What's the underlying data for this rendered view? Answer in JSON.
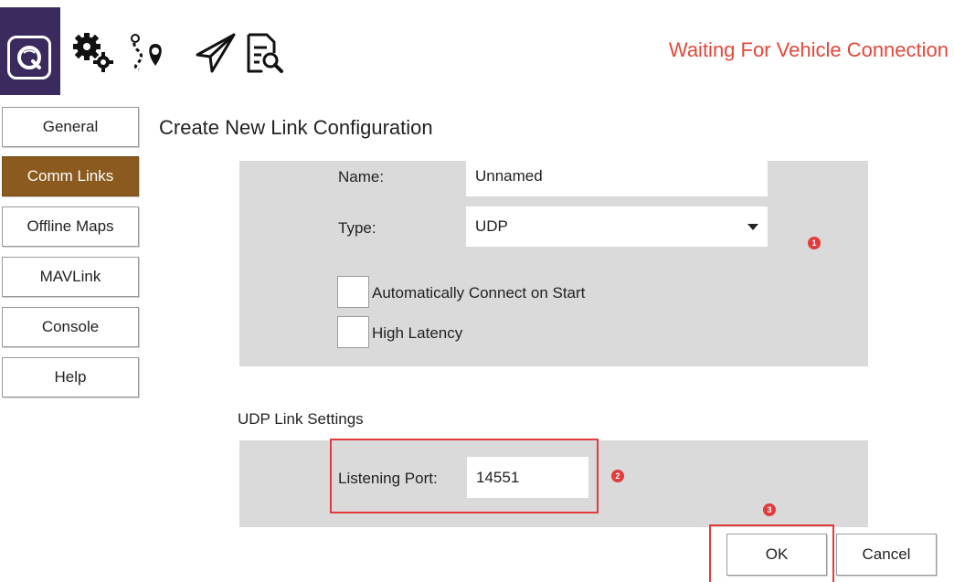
{
  "toolbar": {
    "status": "Waiting For Vehicle Connection",
    "status_color": "#e2483a",
    "icons": [
      "app-logo-icon",
      "settings-gears-icon",
      "plan-route-icon",
      "fly-paper-plane-icon",
      "analyze-document-icon"
    ]
  },
  "sidebar": {
    "items": [
      {
        "label": "General",
        "active": false
      },
      {
        "label": "Comm Links",
        "active": true
      },
      {
        "label": "Offline Maps",
        "active": false
      },
      {
        "label": "MAVLink",
        "active": false
      },
      {
        "label": "Console",
        "active": false
      },
      {
        "label": "Help",
        "active": false
      }
    ],
    "active_color": "#8a5a1e"
  },
  "main": {
    "title": "Create New Link Configuration",
    "name_label": "Name:",
    "name_value": "Unnamed",
    "type_label": "Type:",
    "type_value": "UDP",
    "auto_connect_label": "Automatically Connect on Start",
    "auto_connect_checked": false,
    "high_latency_label": "High Latency",
    "high_latency_checked": false,
    "udp_heading": "UDP Link Settings",
    "listening_port_label": "Listening Port:",
    "listening_port_value": "14551"
  },
  "dialog": {
    "ok_label": "OK",
    "cancel_label": "Cancel"
  },
  "annotations": {
    "markers": [
      "1",
      "2",
      "3"
    ],
    "highlight_color": "#e23b3b"
  }
}
